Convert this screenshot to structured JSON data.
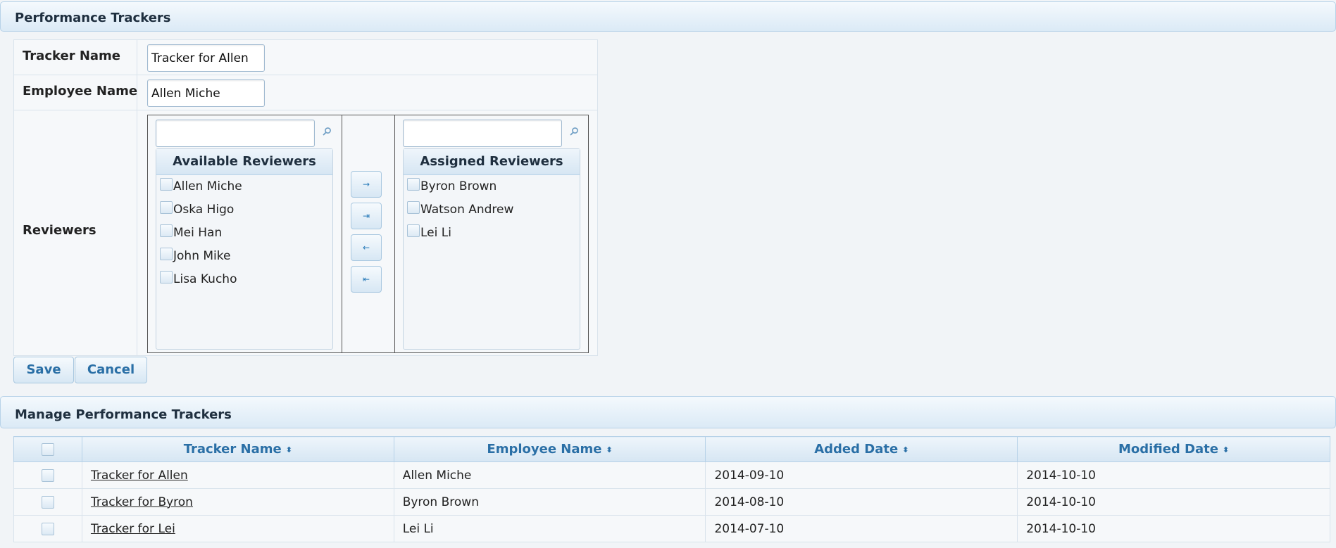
{
  "form_section": {
    "title": "Performance Trackers",
    "tracker_name_label": "Tracker Name",
    "tracker_name_value": "Tracker for Allen",
    "employee_name_label": "Employee Name",
    "employee_name_value": "Allen Miche",
    "reviewers_label": "Reviewers",
    "available": {
      "title": "Available Reviewers",
      "search_value": "",
      "items": [
        "Allen Miche",
        "Oska Higo",
        "Mei Han",
        "John Mike",
        "Lisa Kucho"
      ]
    },
    "assigned": {
      "title": "Assigned Reviewers",
      "search_value": "",
      "items": [
        "Byron Brown",
        "Watson Andrew",
        "Lei Li"
      ]
    },
    "move_buttons": {
      "add": "→",
      "add_all": "⇥",
      "remove": "←",
      "remove_all": "⇤"
    },
    "save_label": "Save",
    "cancel_label": "Cancel"
  },
  "manage_section": {
    "title": "Manage Performance Trackers",
    "columns": [
      "Tracker Name",
      "Employee Name",
      "Added Date",
      "Modified Date"
    ],
    "sort_glyph": "⬍",
    "rows": [
      {
        "tracker": "Tracker for Allen",
        "employee": "Allen Miche",
        "added": "2014-09-10",
        "modified": "2014-10-10"
      },
      {
        "tracker": "Tracker for Byron",
        "employee": "Byron Brown",
        "added": "2014-08-10",
        "modified": "2014-10-10"
      },
      {
        "tracker": "Tracker for Lei",
        "employee": "Lei Li",
        "added": "2014-07-10",
        "modified": "2014-10-10"
      }
    ]
  },
  "colors": {
    "header_gradient_top": "#f4f9fd",
    "header_gradient_bottom": "#dbeaf6",
    "link_blue": "#2a6fa6",
    "background": "#f1f4f7"
  },
  "icons": {
    "search": "search-icon",
    "sort": "sort-icon",
    "checkbox": "checkbox-icon"
  }
}
